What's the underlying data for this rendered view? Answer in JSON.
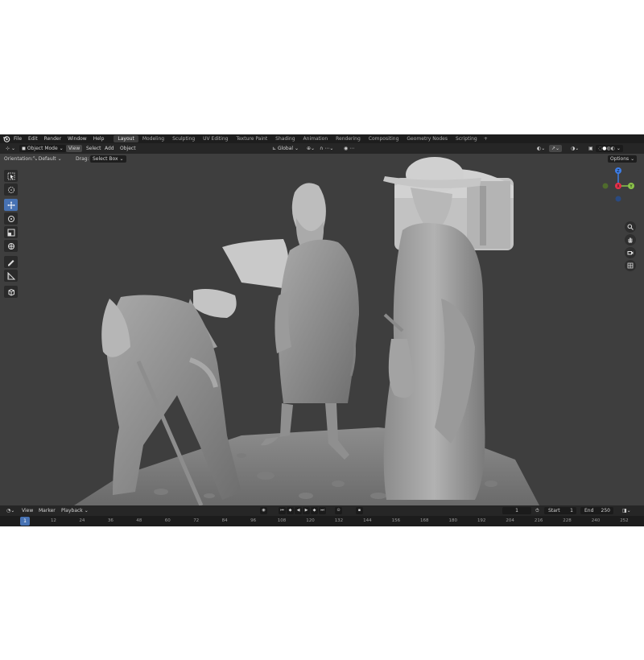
{
  "menubar": {
    "items": [
      "File",
      "Edit",
      "Render",
      "Window",
      "Help"
    ],
    "workspaces": [
      "Layout",
      "Modeling",
      "Sculpting",
      "UV Editing",
      "Texture Paint",
      "Shading",
      "Animation",
      "Rendering",
      "Compositing",
      "Geometry Nodes",
      "Scripting"
    ],
    "active_workspace": "Layout",
    "add_tab": "+"
  },
  "header": {
    "mode": "Object Mode",
    "menus": [
      "View",
      "Select",
      "Add",
      "Object"
    ],
    "transform_orientation": "Global"
  },
  "tool_settings": {
    "orientation_label": "Orientation:",
    "orientation_value": "Default",
    "drag_label": "Drag:",
    "drag_value": "Select Box",
    "options": "Options"
  },
  "gizmo": {
    "x": "X",
    "y": "Y",
    "z": "Z",
    "colors": {
      "x": "#e8304a",
      "y": "#8bc34a",
      "z": "#3d7ee8"
    }
  },
  "timeline": {
    "menus": [
      "View",
      "Marker",
      "Playback"
    ],
    "current_frame": "1",
    "start_label": "Start",
    "start_value": "1",
    "end_label": "End",
    "end_value": "250",
    "ticks": [
      "1",
      "12",
      "24",
      "36",
      "48",
      "60",
      "72",
      "84",
      "96",
      "108",
      "120",
      "132",
      "144",
      "156",
      "168",
      "180",
      "192",
      "204",
      "216",
      "228",
      "240",
      "252"
    ]
  },
  "colors": {
    "accent": "#4772b3",
    "background": "#3e3e3e"
  }
}
